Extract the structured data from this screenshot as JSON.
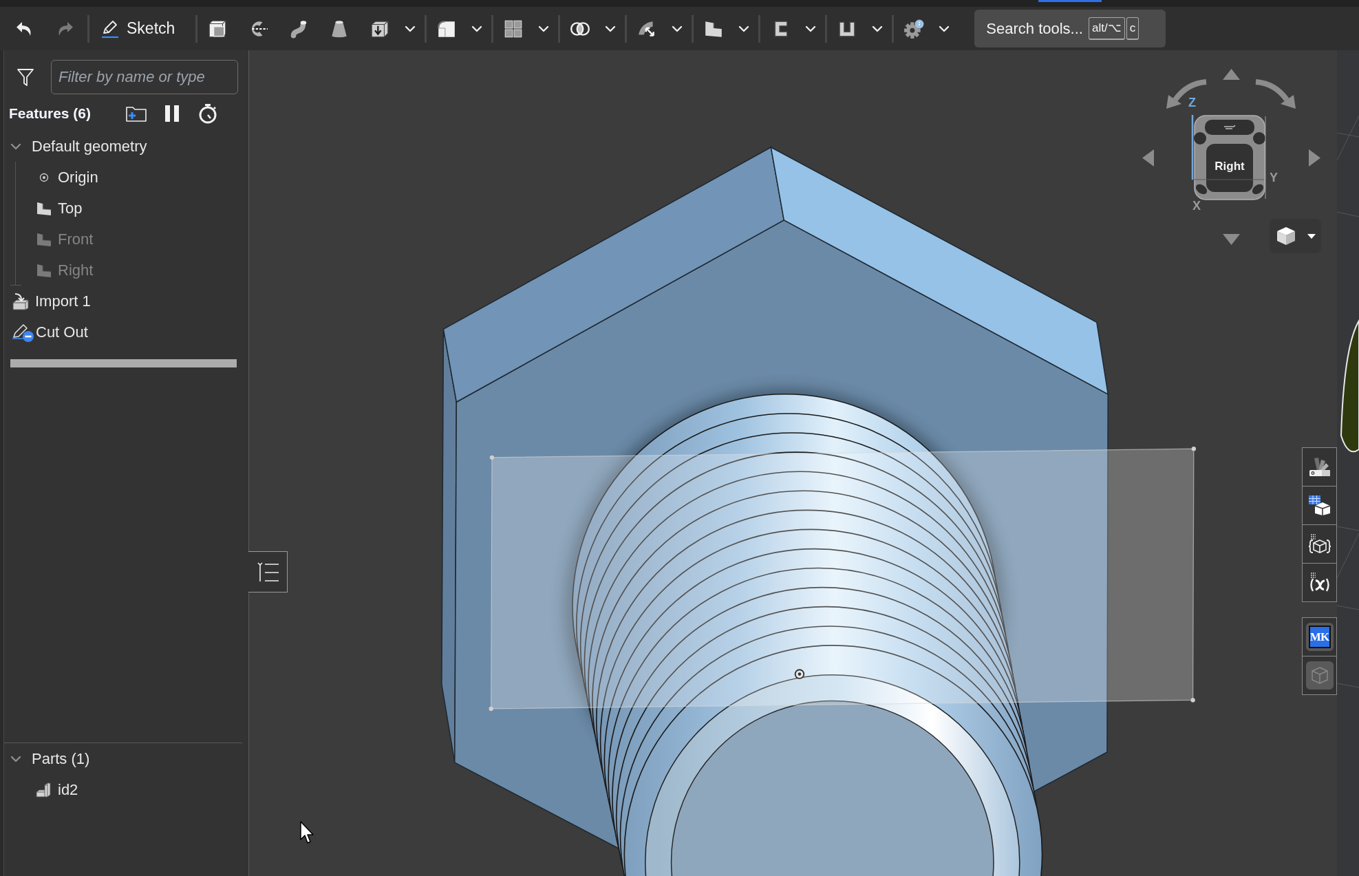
{
  "toolbar": {
    "undo": {
      "disabled": false
    },
    "redo": {
      "disabled": true
    },
    "sketch": {
      "label": "Sketch"
    },
    "tool_groups": [
      {
        "tools": [
          {
            "dropdown": false
          },
          {
            "dropdown": false
          },
          {
            "dropdown": false
          },
          {
            "dropdown": false
          },
          {
            "dropdown": true
          }
        ]
      },
      {
        "tools": [
          {
            "dropdown": true
          }
        ]
      },
      {
        "tools": [
          {
            "dropdown": true
          }
        ]
      },
      {
        "tools": [
          {
            "dropdown": true
          }
        ]
      },
      {
        "tools": [
          {
            "dropdown": true
          }
        ]
      },
      {
        "tools": [
          {
            "dropdown": true
          }
        ]
      },
      {
        "tools": [
          {
            "dropdown": true
          }
        ]
      },
      {
        "tools": [
          {
            "dropdown": true
          }
        ]
      },
      {
        "tools": [
          {
            "dropdown": true
          }
        ]
      }
    ],
    "search": {
      "label": "Search tools...",
      "shortcut_keys": [
        "alt/⌥",
        "c"
      ]
    }
  },
  "feature_panel": {
    "filter": {
      "placeholder": "Filter by name or type"
    },
    "title": "Features (6)",
    "tree": [
      {
        "kind": "group",
        "label": "Default geometry",
        "expanded": true,
        "children": [
          {
            "kind": "point",
            "label": "Origin",
            "visible": true
          },
          {
            "kind": "plane",
            "label": "Top",
            "visible": true
          },
          {
            "kind": "plane",
            "label": "Front",
            "visible": false
          },
          {
            "kind": "plane",
            "label": "Right",
            "visible": false
          }
        ]
      },
      {
        "kind": "import",
        "label": "Import 1"
      },
      {
        "kind": "sketch_cut",
        "label": "Cut Out"
      }
    ],
    "parts": {
      "title": "Parts (1)",
      "expanded": true,
      "items": [
        {
          "label": "id2"
        }
      ]
    }
  },
  "view_cube": {
    "face": "Right",
    "axes": [
      {
        "label": "Z"
      },
      {
        "label": "Y"
      },
      {
        "label": "X"
      }
    ]
  },
  "right_toolbar": {
    "groups": [
      {
        "buttons": [
          {
            "kind": "icon",
            "disabled": false
          },
          {
            "kind": "icon",
            "disabled": false
          },
          {
            "kind": "icon",
            "disabled": false
          },
          {
            "kind": "icon",
            "disabled": false
          }
        ]
      },
      {
        "buttons": [
          {
            "kind": "badge",
            "text": "MK",
            "disabled": false
          },
          {
            "kind": "icon",
            "disabled": true
          }
        ]
      }
    ]
  }
}
